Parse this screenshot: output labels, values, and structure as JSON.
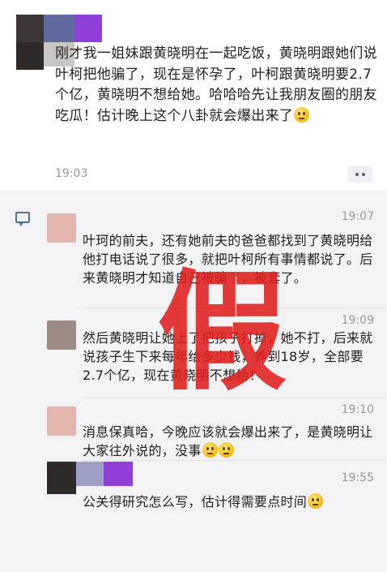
{
  "post": {
    "text": "刚才我一姐妹跟黄晓明在一起吃饭，黄晓明跟她们说叶柯把他骗了，现在是怀孕了，叶柯跟黄晓明要2.7个亿，黄晓明不想给她。哈哈哈先让我朋友圈的朋友吃瓜！估计晚上这个八卦就会爆出来了",
    "time": "19:03",
    "emoji": "thinking-face"
  },
  "comments": [
    {
      "time": "19:07",
      "text": "叶珂的前夫，还有她前夫的爸爸都找到了黄晓明给他打电话说了很多，就把叶柯所有事情都说了。后来黄晓明才知道自己被骗了，被套了。"
    },
    {
      "time": "19:09",
      "text": "然后黄晓明让她上了把孩子打掉，她不打，后来就说孩子生下来每年给多少钱，养到18岁，全部要2.7个亿，现在黄晓明不想给！"
    },
    {
      "time": "19:10",
      "text": "消息保真哈，今晚应该就会爆出来了，是黄晓明让大家往外说的，没事"
    },
    {
      "time": "19:55",
      "text": "公关得研究怎么写，估计得需要点时间"
    }
  ],
  "overlay": {
    "stamp": "假"
  },
  "colors": {
    "stamp": "#e11f1f",
    "comment_bg": "#f3f3f5",
    "link_blue": "#56708f"
  }
}
